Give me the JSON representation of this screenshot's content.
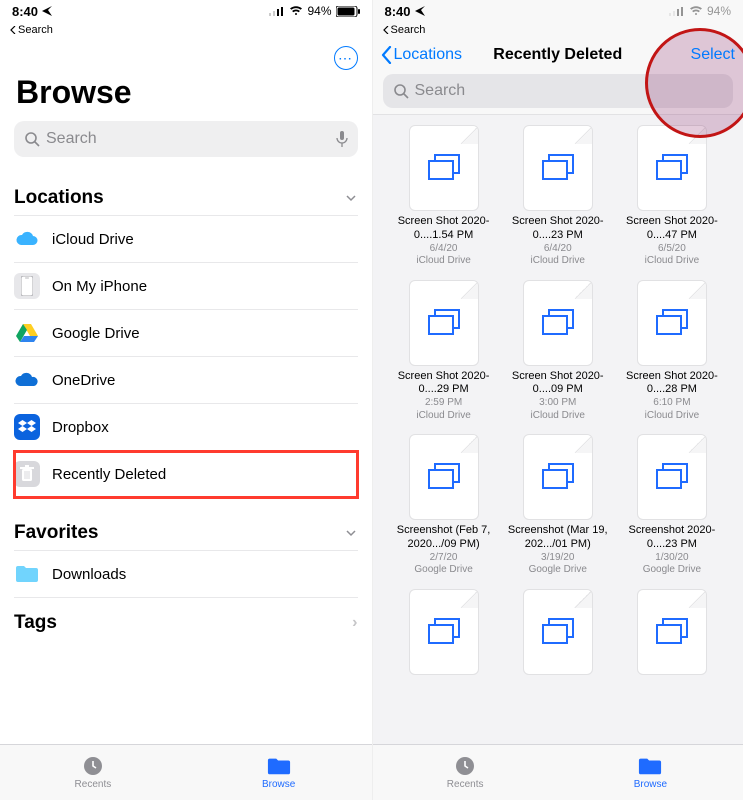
{
  "status": {
    "time": "8:40",
    "back": "Search",
    "battery": "94%"
  },
  "left": {
    "title": "Browse",
    "search_placeholder": "Search",
    "sections": {
      "locations": {
        "title": "Locations",
        "items": [
          {
            "label": "iCloud Drive"
          },
          {
            "label": "On My iPhone"
          },
          {
            "label": "Google Drive"
          },
          {
            "label": "OneDrive"
          },
          {
            "label": "Dropbox"
          },
          {
            "label": "Recently Deleted"
          }
        ]
      },
      "favorites": {
        "title": "Favorites",
        "items": [
          {
            "label": "Downloads"
          }
        ]
      },
      "tags": {
        "title": "Tags"
      }
    }
  },
  "tabs": {
    "recents": "Recents",
    "browse": "Browse"
  },
  "right": {
    "back": "Locations",
    "title": "Recently Deleted",
    "select": "Select",
    "search_placeholder": "Search",
    "files": [
      {
        "name": "Screen Shot 2020-0....1.54 PM",
        "date": "6/4/20",
        "loc": "iCloud Drive"
      },
      {
        "name": "Screen Shot 2020-0....23 PM",
        "date": "6/4/20",
        "loc": "iCloud Drive"
      },
      {
        "name": "Screen Shot 2020-0....47 PM",
        "date": "6/5/20",
        "loc": "iCloud Drive"
      },
      {
        "name": "Screen Shot 2020-0....29 PM",
        "date": "2:59 PM",
        "loc": "iCloud Drive"
      },
      {
        "name": "Screen Shot 2020-0....09 PM",
        "date": "3:00 PM",
        "loc": "iCloud Drive"
      },
      {
        "name": "Screen Shot 2020-0....28 PM",
        "date": "6:10 PM",
        "loc": "iCloud Drive"
      },
      {
        "name": "Screenshot (Feb 7, 2020.../09 PM)",
        "date": "2/7/20",
        "loc": "Google Drive"
      },
      {
        "name": "Screenshot (Mar 19, 202.../01 PM)",
        "date": "3/19/20",
        "loc": "Google Drive"
      },
      {
        "name": "Screenshot 2020-0....23 PM",
        "date": "1/30/20",
        "loc": "Google Drive"
      },
      {
        "name": "",
        "date": "",
        "loc": ""
      },
      {
        "name": "",
        "date": "",
        "loc": ""
      },
      {
        "name": "",
        "date": "",
        "loc": ""
      }
    ]
  }
}
